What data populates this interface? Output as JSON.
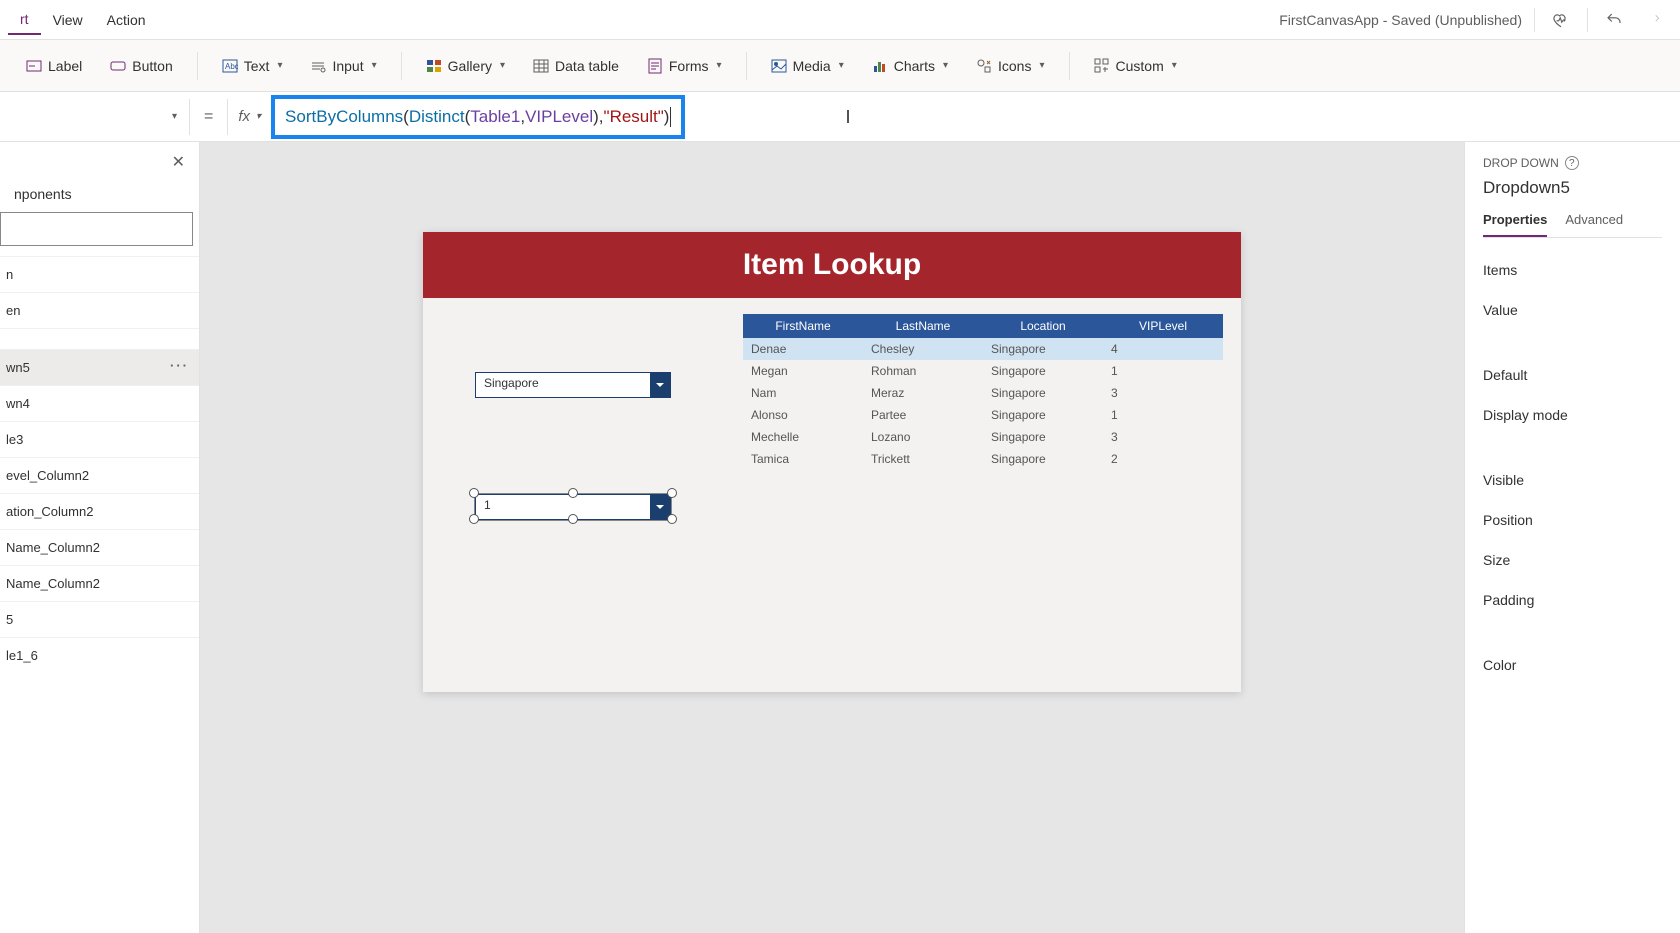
{
  "menu": {
    "items": [
      "rt",
      "View",
      "Action"
    ],
    "app_status": "FirstCanvasApp - Saved (Unpublished)"
  },
  "ribbon": {
    "label": "Label",
    "button": "Button",
    "text": "Text",
    "input": "Input",
    "gallery": "Gallery",
    "datatable": "Data table",
    "forms": "Forms",
    "media": "Media",
    "charts": "Charts",
    "icons": "Icons",
    "custom": "Custom"
  },
  "formula": {
    "equals": "=",
    "fx": "fx",
    "fn1": "SortByColumns",
    "p1": "(",
    "fn2": "Distinct",
    "p2": "(",
    "id1": "Table1",
    "c1": ", ",
    "id2": "VIPLevel",
    "p3": ")",
    "c2": ", ",
    "str": "\"Result\"",
    "p4": ")"
  },
  "tree": {
    "tab_components": "nponents",
    "items": [
      "n",
      "en",
      "",
      "wn5",
      "wn4",
      "le3",
      "evel_Column2",
      "ation_Column2",
      "Name_Column2",
      "Name_Column2",
      "5",
      "le1_6"
    ],
    "selected_index": 3
  },
  "canvas": {
    "title": "Item Lookup",
    "dropdown1_value": "Singapore",
    "dropdown2_value": "1",
    "table": {
      "headers": [
        "FirstName",
        "LastName",
        "Location",
        "VIPLevel"
      ],
      "rows": [
        [
          "Denae",
          "Chesley",
          "Singapore",
          "4"
        ],
        [
          "Megan",
          "Rohman",
          "Singapore",
          "1"
        ],
        [
          "Nam",
          "Meraz",
          "Singapore",
          "3"
        ],
        [
          "Alonso",
          "Partee",
          "Singapore",
          "1"
        ],
        [
          "Mechelle",
          "Lozano",
          "Singapore",
          "3"
        ],
        [
          "Tamica",
          "Trickett",
          "Singapore",
          "2"
        ]
      ]
    }
  },
  "props": {
    "heading": "DROP DOWN",
    "name": "Dropdown5",
    "tab_properties": "Properties",
    "tab_advanced": "Advanced",
    "rows": [
      "Items",
      "Value",
      "Default",
      "Display mode",
      "Visible",
      "Position",
      "Size",
      "Padding",
      "Color"
    ]
  }
}
